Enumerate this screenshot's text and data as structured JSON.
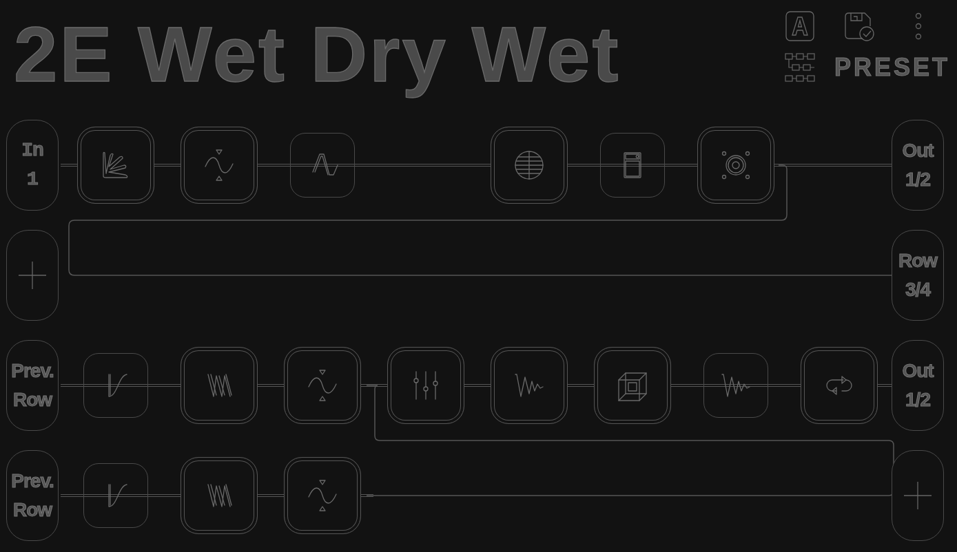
{
  "title": "2E Wet Dry Wet",
  "toolbar": {
    "preset_label": "PRESET"
  },
  "rows": [
    {
      "start": {
        "kind": "input",
        "lines": [
          "In",
          "1"
        ]
      },
      "slots": [
        {
          "kind": "burst",
          "enabled": true
        },
        {
          "kind": "sine",
          "enabled": true
        },
        {
          "kind": "pulse",
          "enabled": false
        },
        {
          "kind": "empty"
        },
        {
          "kind": "globe",
          "enabled": true
        },
        {
          "kind": "amp",
          "enabled": false
        },
        {
          "kind": "speaker",
          "enabled": true
        },
        {
          "kind": "empty"
        }
      ],
      "end": {
        "kind": "output",
        "lines": [
          "Out",
          "1/2"
        ]
      }
    },
    {
      "start": {
        "kind": "add"
      },
      "slots": [],
      "end": {
        "kind": "output",
        "lines": [
          "Row",
          "3/4"
        ]
      }
    },
    {
      "start": {
        "kind": "output",
        "lines": [
          "Prev.",
          "Row"
        ]
      },
      "slots": [
        {
          "kind": "curve",
          "enabled": false
        },
        {
          "kind": "wavy",
          "enabled": true
        },
        {
          "kind": "sine",
          "enabled": true
        },
        {
          "kind": "sliders",
          "enabled": true
        },
        {
          "kind": "decay",
          "enabled": true
        },
        {
          "kind": "cube",
          "enabled": true
        },
        {
          "kind": "decay",
          "enabled": false
        },
        {
          "kind": "loop",
          "enabled": true
        }
      ],
      "end": {
        "kind": "output",
        "lines": [
          "Out",
          "1/2"
        ]
      }
    },
    {
      "start": {
        "kind": "output",
        "lines": [
          "Prev.",
          "Row"
        ]
      },
      "slots": [
        {
          "kind": "curve",
          "enabled": false
        },
        {
          "kind": "wavy",
          "enabled": true
        },
        {
          "kind": "sine",
          "enabled": true
        }
      ],
      "end": {
        "kind": "add"
      }
    }
  ]
}
